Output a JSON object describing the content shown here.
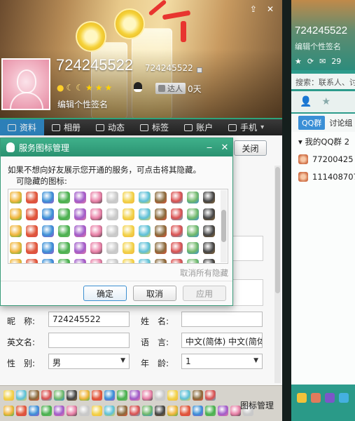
{
  "profile": {
    "nickname": "724245522",
    "qq_number": "724245522",
    "signature": "编辑个性签名",
    "level_icons": [
      "sun",
      "moon",
      "moon",
      "star",
      "star",
      "star"
    ],
    "vip_label": "达人",
    "days": "0天",
    "window_controls": [
      "pin-icon",
      "close-icon"
    ]
  },
  "tabs": [
    {
      "label": "资料",
      "icon": "profile-card-icon",
      "active": true
    },
    {
      "label": "相册",
      "icon": "photo-album-icon",
      "active": false
    },
    {
      "label": "动态",
      "icon": "feed-icon",
      "active": false
    },
    {
      "label": "标签",
      "icon": "bookmark-icon",
      "active": false
    },
    {
      "label": "账户",
      "icon": "wallet-icon",
      "active": false
    },
    {
      "label": "手机",
      "icon": "phone-icon",
      "active": false
    }
  ],
  "close_button_label": "关闭",
  "dialog": {
    "title": "服务图标管理",
    "description": "如果不想向好友展示您开通的服务，可点击将其隐藏。",
    "subtitle": "可隐藏的图标:",
    "unhide_all": "取消所有隐藏",
    "ok": "确定",
    "cancel": "取消",
    "apply": "应用"
  },
  "form": {
    "nickname_label": "昵　称:",
    "nickname_value": "724245522",
    "name_label": "姓　名:",
    "name_value": "",
    "english_label": "英文名:",
    "english_value": "",
    "language_label": "语　言:",
    "language_value": "中文(简体) 中文(简体",
    "gender_label": "性　别:",
    "gender_value": "男",
    "age_label": "年　龄:",
    "age_value": "1"
  },
  "icon_bar": {
    "manage_label": "图标管理"
  },
  "side_panel": {
    "qq_number": "724245522",
    "signature": "编辑个性签名",
    "status_mail_count": "29",
    "search_placeholder": "搜索：联系人、讨",
    "tab_groups": "QQ群",
    "tab_discussions": "讨论组",
    "group_header": "我的QQ群",
    "group_count": "2",
    "groups": [
      "77200425",
      "111408707"
    ]
  },
  "colors": {
    "accent_green": "#2ea37a",
    "tab_active_blue": "#2c7fb8",
    "panel_teal": "#2d9c8c",
    "dialog_title": "#3fb08a"
  }
}
